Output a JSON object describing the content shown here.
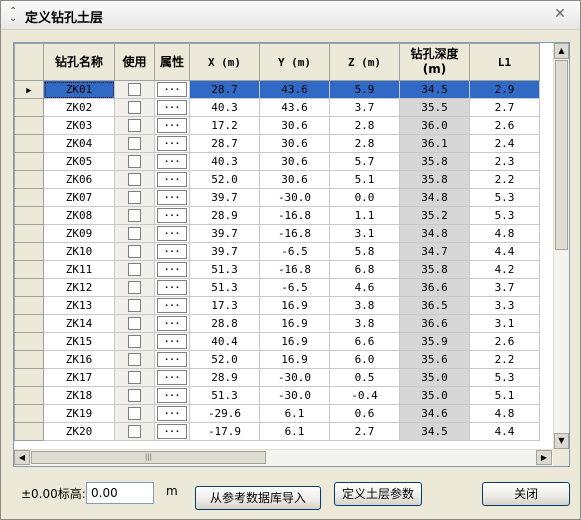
{
  "window": {
    "title": "定义钻孔土层"
  },
  "table": {
    "columns": [
      "钻孔名称",
      "使用",
      "属性",
      "X (m)",
      "Y (m)",
      "Z (m)",
      "钻孔深度(m)",
      "L1"
    ],
    "depth_header_line1": "钻孔深度",
    "depth_header_line2": "(m)",
    "attr_button_label": "...",
    "rows": [
      {
        "name": "ZK01",
        "x": "28.7",
        "y": "43.6",
        "z": "5.9",
        "depth": "34.5",
        "l1": "2.9"
      },
      {
        "name": "ZK02",
        "x": "40.3",
        "y": "43.6",
        "z": "3.7",
        "depth": "35.5",
        "l1": "2.7"
      },
      {
        "name": "ZK03",
        "x": "17.2",
        "y": "30.6",
        "z": "2.8",
        "depth": "36.0",
        "l1": "2.6"
      },
      {
        "name": "ZK04",
        "x": "28.7",
        "y": "30.6",
        "z": "2.8",
        "depth": "36.1",
        "l1": "2.4"
      },
      {
        "name": "ZK05",
        "x": "40.3",
        "y": "30.6",
        "z": "5.7",
        "depth": "35.8",
        "l1": "2.3"
      },
      {
        "name": "ZK06",
        "x": "52.0",
        "y": "30.6",
        "z": "5.1",
        "depth": "35.8",
        "l1": "2.2"
      },
      {
        "name": "ZK07",
        "x": "39.7",
        "y": "-30.0",
        "z": "0.0",
        "depth": "34.8",
        "l1": "5.3"
      },
      {
        "name": "ZK08",
        "x": "28.9",
        "y": "-16.8",
        "z": "1.1",
        "depth": "35.2",
        "l1": "5.3"
      },
      {
        "name": "ZK09",
        "x": "39.7",
        "y": "-16.8",
        "z": "3.1",
        "depth": "34.8",
        "l1": "4.8"
      },
      {
        "name": "ZK10",
        "x": "39.7",
        "y": "-6.5",
        "z": "5.8",
        "depth": "34.7",
        "l1": "4.4"
      },
      {
        "name": "ZK11",
        "x": "51.3",
        "y": "-16.8",
        "z": "6.8",
        "depth": "35.8",
        "l1": "4.2"
      },
      {
        "name": "ZK12",
        "x": "51.3",
        "y": "-6.5",
        "z": "4.6",
        "depth": "36.6",
        "l1": "3.7"
      },
      {
        "name": "ZK13",
        "x": "17.3",
        "y": "16.9",
        "z": "3.8",
        "depth": "36.5",
        "l1": "3.3"
      },
      {
        "name": "ZK14",
        "x": "28.8",
        "y": "16.9",
        "z": "3.8",
        "depth": "36.6",
        "l1": "3.1"
      },
      {
        "name": "ZK15",
        "x": "40.4",
        "y": "16.9",
        "z": "6.6",
        "depth": "35.9",
        "l1": "2.6"
      },
      {
        "name": "ZK16",
        "x": "52.0",
        "y": "16.9",
        "z": "6.0",
        "depth": "35.6",
        "l1": "2.2"
      },
      {
        "name": "ZK17",
        "x": "28.9",
        "y": "-30.0",
        "z": "0.5",
        "depth": "35.0",
        "l1": "5.3"
      },
      {
        "name": "ZK18",
        "x": "51.3",
        "y": "-30.0",
        "z": "-0.4",
        "depth": "35.0",
        "l1": "5.1"
      },
      {
        "name": "ZK19",
        "x": "-29.6",
        "y": "6.1",
        "z": "0.6",
        "depth": "34.6",
        "l1": "4.8"
      },
      {
        "name": "ZK20",
        "x": "-17.9",
        "y": "6.1",
        "z": "2.7",
        "depth": "34.5",
        "l1": "4.4"
      }
    ]
  },
  "footer": {
    "elevation_label": "±0.00标高:",
    "elevation_value": "0.00",
    "elevation_unit": "m",
    "import_button": "从参考数据库导入",
    "define_button": "定义土层参数",
    "close_button": "关闭"
  },
  "colors": {
    "selection": "#316ac5",
    "depth_column": "#d7d7d7"
  }
}
